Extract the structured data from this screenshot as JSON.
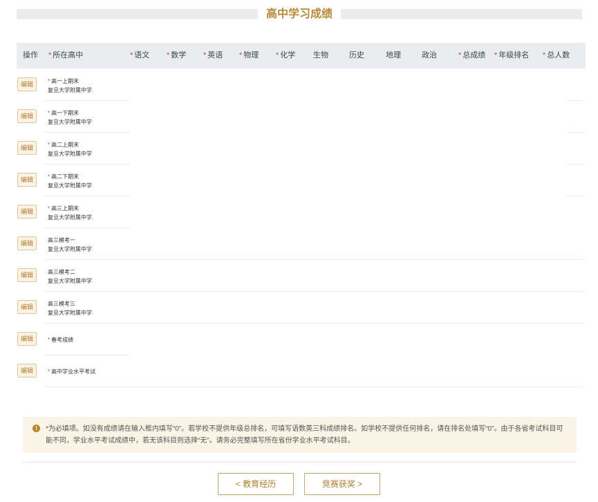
{
  "page": {
    "title": "高中学习成绩"
  },
  "table": {
    "headers": [
      {
        "label": "操作",
        "required": false
      },
      {
        "label": "所在高中",
        "required": true
      },
      {
        "label": "语文",
        "required": true
      },
      {
        "label": "数学",
        "required": true
      },
      {
        "label": "英语",
        "required": true
      },
      {
        "label": "物理",
        "required": true
      },
      {
        "label": "化学",
        "required": true
      },
      {
        "label": "生物",
        "required": false
      },
      {
        "label": "历史",
        "required": false
      },
      {
        "label": "地理",
        "required": false
      },
      {
        "label": "政治",
        "required": false
      },
      {
        "label": "总成绩",
        "required": true
      },
      {
        "label": "年级排名",
        "required": true
      },
      {
        "label": "总人数",
        "required": true
      }
    ],
    "edit_label": "编辑",
    "required_mark": "*",
    "rows": [
      {
        "exam": "高一上期末",
        "required": true,
        "school": "复旦大学附属中学"
      },
      {
        "exam": "高一下期末",
        "required": true,
        "school": "复旦大学附属中学"
      },
      {
        "exam": "高二上期末",
        "required": true,
        "school": "复旦大学附属中学"
      },
      {
        "exam": "高二下期末",
        "required": true,
        "school": "复旦大学附属中学"
      },
      {
        "exam": "高三上期末",
        "required": true,
        "school": "复旦大学附属中学"
      },
      {
        "exam": "高三模考一",
        "required": false,
        "school": "复旦大学附属中学"
      },
      {
        "exam": "高三模考二",
        "required": false,
        "school": "复旦大学附属中学"
      },
      {
        "exam": "高三模考三",
        "required": false,
        "school": "复旦大学附属中学"
      },
      {
        "exam": "春考成绩",
        "required": true,
        "school": ""
      },
      {
        "exam": "高中学业水平考试",
        "required": true,
        "school": ""
      }
    ]
  },
  "notice": {
    "icon": "info-icon",
    "text": "*为必填项。如没有成绩请在输入框内填写“0”。若学校不提供年级总排名，可填写语数英三科成绩排名。如学校不提供任何排名，请在排名处填写“0”。由于各省考试科目可能不同，学业水平考试成绩中，若无该科目则选择“无”。请务必完整填写所在省份学业水平考试科目。"
  },
  "nav": {
    "prev_label": "< 教育经历",
    "next_label": "竞赛获奖 >"
  },
  "colors": {
    "accent": "#b88a3a",
    "required": "#e03c31",
    "header_bg": "#e9ecf0",
    "notice_bg": "#fbf3e5"
  }
}
